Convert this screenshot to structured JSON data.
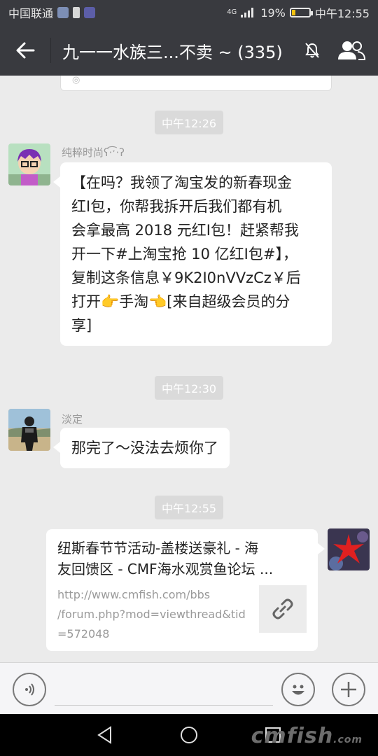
{
  "status_bar": {
    "carrier": "中国联通",
    "network": "4G",
    "battery": "19%",
    "time": "中午12:55"
  },
  "header": {
    "title": "九一一水族三...不卖 ~ (335)"
  },
  "messages": {
    "time1": "中午12:26",
    "msg1": {
      "sender": "纯粹时尚ʕ·͡ˑ·ʔ",
      "lines": [
        "【在吗？我领了淘宝发的新春现金",
        "红I包，你帮我拆开后我们都有机",
        "会拿最高 2018 元红I包！赶紧帮我",
        "开一下#上淘宝抢 10 亿红I包#】，",
        "复制这条信息￥9K2I0nVVzCz￥后",
        "打开👉手淘👈[来自超级会员的分",
        "享]"
      ]
    },
    "time2": "中午12:30",
    "msg2": {
      "sender": "淡定",
      "text": "那完了～没法去烦你了"
    },
    "time3": "中午12:55",
    "link": {
      "title_line1": "纽斯春节节活动-盖楼送豪礼 - 海",
      "title_line2": "友回馈区 - CMF海水观赏鱼论坛 ...",
      "url_line1": "http://www.cmfish.com/bbs",
      "url_line2": "/forum.php?mod=viewthread&tid",
      "url_line3": "=572048"
    }
  },
  "watermark": {
    "text": "cmfish",
    "suffix": ".com"
  },
  "icons": {
    "back": "back-arrow-icon",
    "mute": "mute-bell-icon",
    "group": "group-people-icon",
    "voice": "voice-icon",
    "emoji": "emoji-icon",
    "plus": "plus-icon",
    "link": "link-icon"
  }
}
